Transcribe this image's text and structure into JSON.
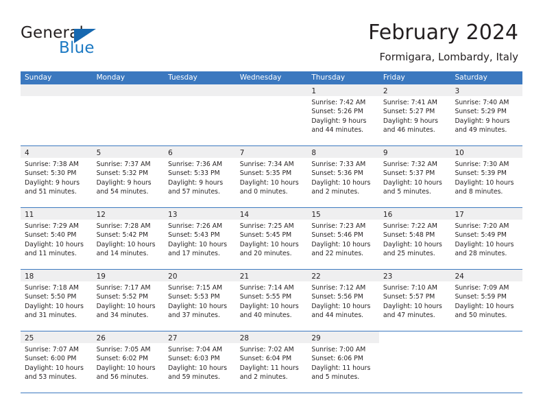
{
  "brand": {
    "name_part1": "General",
    "name_part2": "Blue",
    "logo_icon": "triangle-icon"
  },
  "header": {
    "title": "February 2024",
    "subtitle": "Formigara, Lombardy, Italy"
  },
  "colors": {
    "header_blue": "#3b78bf",
    "brand_blue": "#1b79c3",
    "daynum_band": "#efeff0",
    "text": "#231f20"
  },
  "weekdays": [
    "Sunday",
    "Monday",
    "Tuesday",
    "Wednesday",
    "Thursday",
    "Friday",
    "Saturday"
  ],
  "weeks": [
    [
      {
        "day": "",
        "state": "empty"
      },
      {
        "day": "",
        "state": "empty"
      },
      {
        "day": "",
        "state": "empty"
      },
      {
        "day": "",
        "state": "empty"
      },
      {
        "day": "1",
        "sunrise": "Sunrise: 7:42 AM",
        "sunset": "Sunset: 5:26 PM",
        "daylight1": "Daylight: 9 hours",
        "daylight2": "and 44 minutes."
      },
      {
        "day": "2",
        "sunrise": "Sunrise: 7:41 AM",
        "sunset": "Sunset: 5:27 PM",
        "daylight1": "Daylight: 9 hours",
        "daylight2": "and 46 minutes."
      },
      {
        "day": "3",
        "sunrise": "Sunrise: 7:40 AM",
        "sunset": "Sunset: 5:29 PM",
        "daylight1": "Daylight: 9 hours",
        "daylight2": "and 49 minutes."
      }
    ],
    [
      {
        "day": "4",
        "sunrise": "Sunrise: 7:38 AM",
        "sunset": "Sunset: 5:30 PM",
        "daylight1": "Daylight: 9 hours",
        "daylight2": "and 51 minutes."
      },
      {
        "day": "5",
        "sunrise": "Sunrise: 7:37 AM",
        "sunset": "Sunset: 5:32 PM",
        "daylight1": "Daylight: 9 hours",
        "daylight2": "and 54 minutes."
      },
      {
        "day": "6",
        "sunrise": "Sunrise: 7:36 AM",
        "sunset": "Sunset: 5:33 PM",
        "daylight1": "Daylight: 9 hours",
        "daylight2": "and 57 minutes."
      },
      {
        "day": "7",
        "sunrise": "Sunrise: 7:34 AM",
        "sunset": "Sunset: 5:35 PM",
        "daylight1": "Daylight: 10 hours",
        "daylight2": "and 0 minutes."
      },
      {
        "day": "8",
        "sunrise": "Sunrise: 7:33 AM",
        "sunset": "Sunset: 5:36 PM",
        "daylight1": "Daylight: 10 hours",
        "daylight2": "and 2 minutes."
      },
      {
        "day": "9",
        "sunrise": "Sunrise: 7:32 AM",
        "sunset": "Sunset: 5:37 PM",
        "daylight1": "Daylight: 10 hours",
        "daylight2": "and 5 minutes."
      },
      {
        "day": "10",
        "sunrise": "Sunrise: 7:30 AM",
        "sunset": "Sunset: 5:39 PM",
        "daylight1": "Daylight: 10 hours",
        "daylight2": "and 8 minutes."
      }
    ],
    [
      {
        "day": "11",
        "sunrise": "Sunrise: 7:29 AM",
        "sunset": "Sunset: 5:40 PM",
        "daylight1": "Daylight: 10 hours",
        "daylight2": "and 11 minutes."
      },
      {
        "day": "12",
        "sunrise": "Sunrise: 7:28 AM",
        "sunset": "Sunset: 5:42 PM",
        "daylight1": "Daylight: 10 hours",
        "daylight2": "and 14 minutes."
      },
      {
        "day": "13",
        "sunrise": "Sunrise: 7:26 AM",
        "sunset": "Sunset: 5:43 PM",
        "daylight1": "Daylight: 10 hours",
        "daylight2": "and 17 minutes."
      },
      {
        "day": "14",
        "sunrise": "Sunrise: 7:25 AM",
        "sunset": "Sunset: 5:45 PM",
        "daylight1": "Daylight: 10 hours",
        "daylight2": "and 20 minutes."
      },
      {
        "day": "15",
        "sunrise": "Sunrise: 7:23 AM",
        "sunset": "Sunset: 5:46 PM",
        "daylight1": "Daylight: 10 hours",
        "daylight2": "and 22 minutes."
      },
      {
        "day": "16",
        "sunrise": "Sunrise: 7:22 AM",
        "sunset": "Sunset: 5:48 PM",
        "daylight1": "Daylight: 10 hours",
        "daylight2": "and 25 minutes."
      },
      {
        "day": "17",
        "sunrise": "Sunrise: 7:20 AM",
        "sunset": "Sunset: 5:49 PM",
        "daylight1": "Daylight: 10 hours",
        "daylight2": "and 28 minutes."
      }
    ],
    [
      {
        "day": "18",
        "sunrise": "Sunrise: 7:18 AM",
        "sunset": "Sunset: 5:50 PM",
        "daylight1": "Daylight: 10 hours",
        "daylight2": "and 31 minutes."
      },
      {
        "day": "19",
        "sunrise": "Sunrise: 7:17 AM",
        "sunset": "Sunset: 5:52 PM",
        "daylight1": "Daylight: 10 hours",
        "daylight2": "and 34 minutes."
      },
      {
        "day": "20",
        "sunrise": "Sunrise: 7:15 AM",
        "sunset": "Sunset: 5:53 PM",
        "daylight1": "Daylight: 10 hours",
        "daylight2": "and 37 minutes."
      },
      {
        "day": "21",
        "sunrise": "Sunrise: 7:14 AM",
        "sunset": "Sunset: 5:55 PM",
        "daylight1": "Daylight: 10 hours",
        "daylight2": "and 40 minutes."
      },
      {
        "day": "22",
        "sunrise": "Sunrise: 7:12 AM",
        "sunset": "Sunset: 5:56 PM",
        "daylight1": "Daylight: 10 hours",
        "daylight2": "and 44 minutes."
      },
      {
        "day": "23",
        "sunrise": "Sunrise: 7:10 AM",
        "sunset": "Sunset: 5:57 PM",
        "daylight1": "Daylight: 10 hours",
        "daylight2": "and 47 minutes."
      },
      {
        "day": "24",
        "sunrise": "Sunrise: 7:09 AM",
        "sunset": "Sunset: 5:59 PM",
        "daylight1": "Daylight: 10 hours",
        "daylight2": "and 50 minutes."
      }
    ],
    [
      {
        "day": "25",
        "sunrise": "Sunrise: 7:07 AM",
        "sunset": "Sunset: 6:00 PM",
        "daylight1": "Daylight: 10 hours",
        "daylight2": "and 53 minutes."
      },
      {
        "day": "26",
        "sunrise": "Sunrise: 7:05 AM",
        "sunset": "Sunset: 6:02 PM",
        "daylight1": "Daylight: 10 hours",
        "daylight2": "and 56 minutes."
      },
      {
        "day": "27",
        "sunrise": "Sunrise: 7:04 AM",
        "sunset": "Sunset: 6:03 PM",
        "daylight1": "Daylight: 10 hours",
        "daylight2": "and 59 minutes."
      },
      {
        "day": "28",
        "sunrise": "Sunrise: 7:02 AM",
        "sunset": "Sunset: 6:04 PM",
        "daylight1": "Daylight: 11 hours",
        "daylight2": "and 2 minutes."
      },
      {
        "day": "29",
        "sunrise": "Sunrise: 7:00 AM",
        "sunset": "Sunset: 6:06 PM",
        "daylight1": "Daylight: 11 hours",
        "daylight2": "and 5 minutes."
      },
      {
        "day": "",
        "state": "blank"
      },
      {
        "day": "",
        "state": "blank"
      }
    ]
  ]
}
